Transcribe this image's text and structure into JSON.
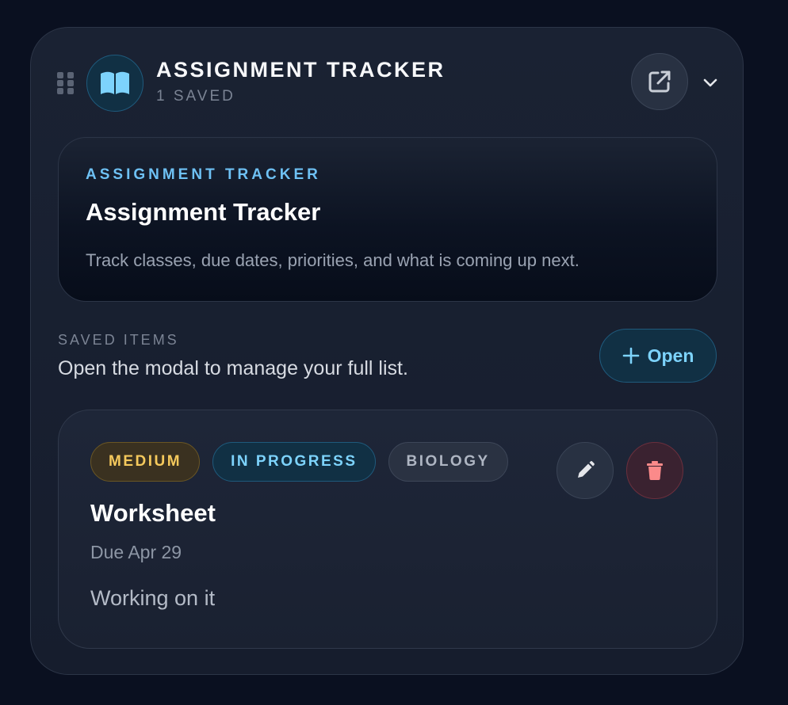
{
  "widget": {
    "title": "ASSIGNMENT TRACKER",
    "subtitle": "1 SAVED",
    "app_icon": "open-book-icon",
    "popout_icon": "external-link-icon",
    "collapse_icon": "chevron-down-icon",
    "drag_icon": "drag-handle-icon"
  },
  "hero": {
    "kicker": "ASSIGNMENT TRACKER",
    "title": "Assignment Tracker",
    "description": "Track classes, due dates, priorities, and what is coming up next."
  },
  "saved_section": {
    "label": "SAVED ITEMS",
    "help": "Open the modal to manage your full list.",
    "open_button": {
      "icon": "plus-icon",
      "label": "Open"
    }
  },
  "items": [
    {
      "priority": "MEDIUM",
      "status": "IN PROGRESS",
      "class_name": "BIOLOGY",
      "title": "Worksheet",
      "due": "Due Apr 29",
      "note": "Working on it",
      "edit_icon": "pencil-icon",
      "delete_icon": "trash-icon"
    }
  ],
  "colors": {
    "background": "#0a1020",
    "card": "#1a2233",
    "accent": "#7dd3fc",
    "priority_medium": "#f5c95c",
    "danger": "#f87171"
  }
}
